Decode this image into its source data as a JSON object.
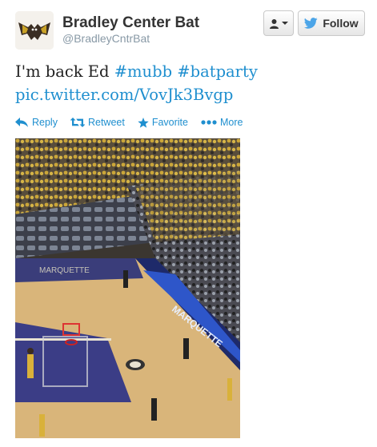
{
  "user": {
    "name": "Bradley Center Bat",
    "handle": "@BradleyCntrBat"
  },
  "header": {
    "follow_label": "Follow"
  },
  "tweet": {
    "text_plain": "I'm back Ed",
    "hashtag1": "#mubb",
    "hashtag2": "#batparty",
    "link": "pic.twitter.com/VovJk3Bvgp"
  },
  "actions": {
    "reply": "Reply",
    "retweet": "Retweet",
    "favorite": "Favorite",
    "more": "More"
  },
  "colors": {
    "link": "#1f8fcf",
    "twitter_bird": "#4ca5e8"
  },
  "icons": {
    "user": "user-icon",
    "bird": "twitter-bird-icon",
    "reply": "reply-icon",
    "retweet": "retweet-icon",
    "favorite": "star-icon",
    "more": "ellipsis-icon"
  }
}
